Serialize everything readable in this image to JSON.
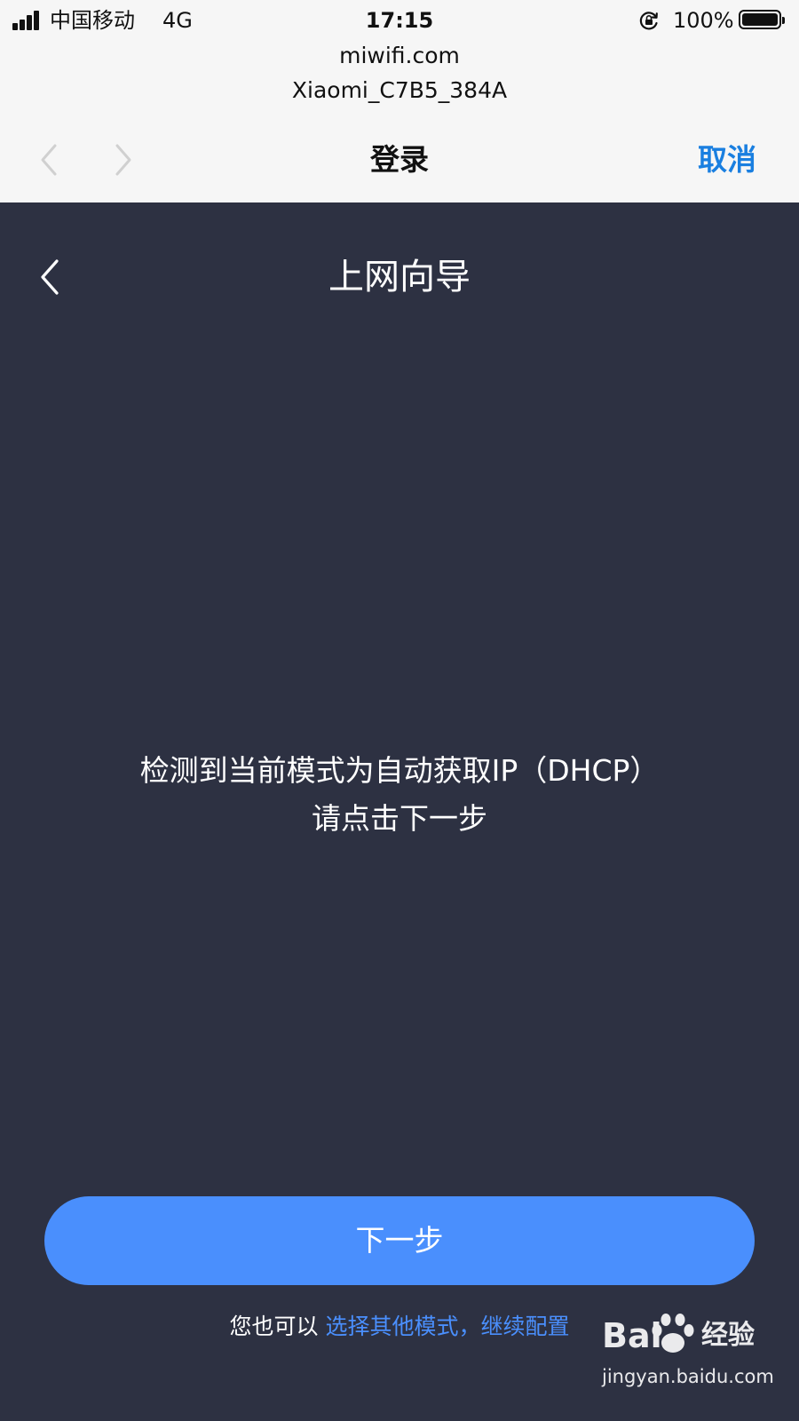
{
  "status_bar": {
    "carrier": "中国移动",
    "network": "4G",
    "time": "17:15",
    "battery_percent": "100%",
    "battery_level": 1.0
  },
  "browser": {
    "url": "miwifi.com",
    "network_name": "Xiaomi_C7B5_384A",
    "title": "登录",
    "cancel_label": "取消"
  },
  "wizard": {
    "title": "上网向导",
    "message_line1": "检测到当前模式为自动获取IP（DHCP）",
    "message_line2": "请点击下一步",
    "next_button": "下一步",
    "hint_prefix": "您也可以 ",
    "hint_link": "选择其他模式，继续配置"
  },
  "watermark": {
    "logo_left": "Bai",
    "logo_right": "经验",
    "url": "jingyan.baidu.com"
  },
  "icons": {
    "signal": "signal-bars-icon",
    "rotation_lock": "rotation-lock-icon",
    "battery": "battery-icon",
    "nav_back": "chevron-left-icon",
    "nav_forward": "chevron-right-icon",
    "wizard_back": "chevron-left-icon",
    "paw": "paw-icon"
  },
  "colors": {
    "wizard_background": "#2d3142",
    "accent_blue": "#4a8ffd",
    "cancel_blue": "#1a7fe0",
    "browser_bar": "#f6f6f6"
  }
}
